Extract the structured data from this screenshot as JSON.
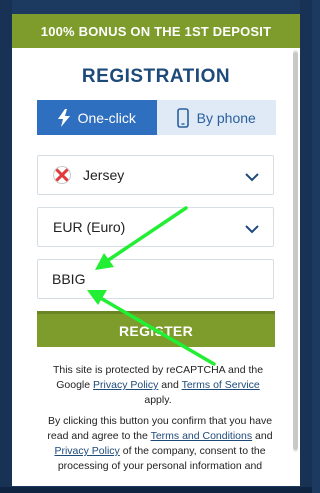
{
  "banner": {
    "text": "100% BONUS ON THE 1ST DEPOSIT"
  },
  "title": "REGISTRATION",
  "tabs": [
    {
      "label": "One-click",
      "icon": "lightning-icon",
      "active": true
    },
    {
      "label": "By phone",
      "icon": "phone-icon",
      "active": false
    }
  ],
  "country": {
    "value": "Jersey",
    "icon": "jersey-flag-icon"
  },
  "currency": {
    "value": "EUR (Euro)"
  },
  "promo": {
    "value": "BBIG"
  },
  "register_button": "REGISTER",
  "legal1": {
    "part1": "This site is protected by reCAPTCHA and the Google ",
    "privacy": "Privacy Policy",
    "and": " and ",
    "terms": "Terms of Service",
    "part2": " apply."
  },
  "legal2": {
    "part1": "By clicking this button you confirm that you have read and agree to the ",
    "terms": "Terms and Conditions",
    "and": " and ",
    "privacy": "Privacy Policy",
    "part2": " of the company, consent to the processing of your personal information and"
  },
  "colors": {
    "brand_green": "#7d9c2b",
    "brand_blue": "#2f6fbf",
    "title_blue": "#1e4a7a",
    "arrow_green": "#22ee33"
  }
}
